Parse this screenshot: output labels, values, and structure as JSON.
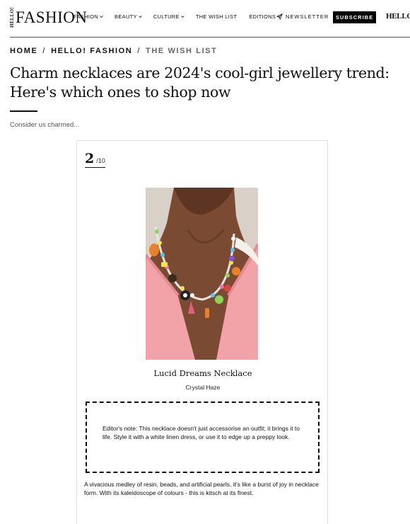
{
  "header": {
    "logo_hello": "HELLO!",
    "logo_fashion": "FASHION",
    "nav": [
      {
        "label": "FASHION",
        "has_dropdown": true
      },
      {
        "label": "BEAUTY",
        "has_dropdown": true
      },
      {
        "label": "CULTURE",
        "has_dropdown": true
      },
      {
        "label": "THE WISH LIST",
        "has_dropdown": false
      },
      {
        "label": "EDITIONS",
        "has_dropdown": true
      }
    ],
    "newsletter_label": "NEWSLETTER",
    "subscribe_label": "SUBSCRIBE",
    "hello_logo": "HELLO!"
  },
  "breadcrumb": {
    "items": [
      "HOME",
      "HELLO! FASHION",
      "THE WISH LIST"
    ],
    "separator": "/"
  },
  "article": {
    "title": "Charm necklaces are 2024's cool-girl jewellery trend: Here's which ones to shop now",
    "subtitle": "Consider us charmed..."
  },
  "slide": {
    "current": "2",
    "total": "/10",
    "product_name": "Lucid Dreams Necklace",
    "brand": "Crystal Haze",
    "editor_note": "Editor's note: This necklace doesn't just accessorise an outfit; it brings it to life. Style it with a white linen dress, or use it to edge up a preppy look.",
    "description": "A vivacious medley of resin, beads, and artificial pearls, it's like a burst of joy in necklace form. With its kaleidoscope of colours - this is kitsch at its finest."
  },
  "colors": {
    "accent": "#000000",
    "background": "#ffffff",
    "breadcrumb_current": "#666666",
    "cardigan_pink": "#f2a3a8",
    "skin": "#7a4a32"
  },
  "icons": {
    "chevron": "chevron-down-icon",
    "newsletter": "paper-plane-icon"
  }
}
